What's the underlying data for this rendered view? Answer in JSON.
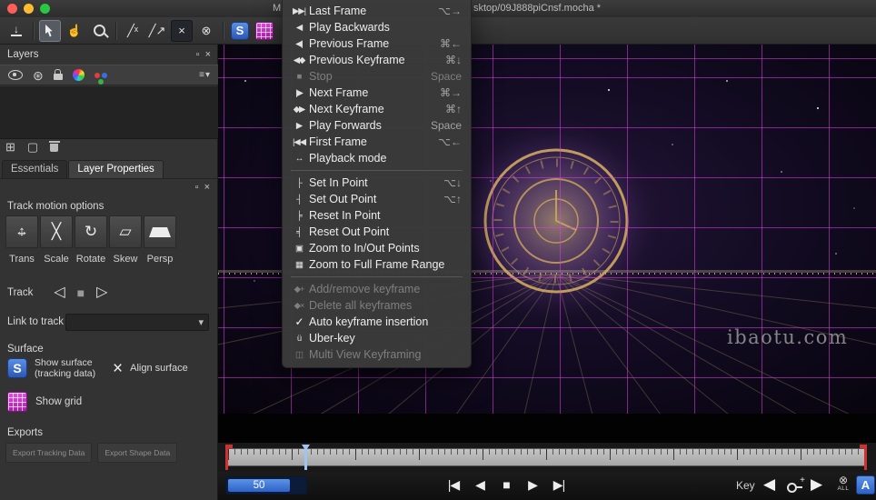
{
  "window": {
    "title_fragment_left": "M",
    "title_fragment_right": "sktop/09J888piCnsf.mocha *"
  },
  "colors": {
    "accent_blue": "#2f6fd0",
    "magenta": "#d936d9",
    "grid_line": "rgba(226,62,226,0.55)",
    "gold": "#cfa85e",
    "red_marker": "#d03030",
    "playhead": "#9cc6f0"
  },
  "icons": {
    "save": "↓",
    "pan": "☝",
    "xspline": "╱ˣ",
    "bezier": "╱↗",
    "x_tool": "×",
    "circle_x": "⊗",
    "surface": "S",
    "float_panel": "▫",
    "close_panel": "×",
    "gear": "⊛",
    "list_menu": "≡▾",
    "group": "⊞",
    "page": "▢",
    "arrow_h": "↔",
    "arrow_v": "↕",
    "scale": "╳",
    "rotate": "↻",
    "skew": "▱",
    "track_back": "◁",
    "track_stop": "■",
    "track_fwd": "▷",
    "select_arrow": "▾",
    "align_x": "×",
    "plus": "+",
    "all_visibility": "⊗",
    "transport_prev_key": "|◀",
    "transport_step_back": "◀",
    "transport_stop": "■",
    "transport_step_fwd": "▶",
    "transport_next_key": "▶|",
    "key_prev": "◀",
    "key_next": "▶"
  },
  "layers_panel": {
    "title": "Layers"
  },
  "tabs": [
    {
      "label": "Essentials",
      "active": false
    },
    {
      "label": "Layer Properties",
      "active": true
    }
  ],
  "track_panel": {
    "motion_title": "Track motion options",
    "motion_buttons": [
      {
        "label": "Trans"
      },
      {
        "label": "Scale"
      },
      {
        "label": "Rotate"
      },
      {
        "label": "Skew"
      },
      {
        "label": "Persp"
      }
    ],
    "track_label": "Track",
    "link_label": "Link to track",
    "surface_label": "Surface",
    "show_surface_line1": "Show surface",
    "show_surface_line2": "(tracking data)",
    "align_surface": "Align surface",
    "show_grid": "Show grid",
    "exports_label": "Exports",
    "export_buttons": [
      "Export Tracking Data",
      "Export Shape Data"
    ]
  },
  "context_menu": {
    "items": [
      {
        "id": "last-frame",
        "icon": "▶▶|",
        "label": "Last Frame",
        "shortcut": "⌥→"
      },
      {
        "id": "play-backwards",
        "icon": "◀",
        "label": "Play Backwards",
        "shortcut": ""
      },
      {
        "id": "previous-frame",
        "icon": "◀|",
        "label": "Previous Frame",
        "shortcut": "⌘←"
      },
      {
        "id": "previous-keyframe",
        "icon": "◀◆",
        "label": "Previous Keyframe",
        "shortcut": "⌘↓"
      },
      {
        "id": "stop",
        "icon": "■",
        "label": "Stop",
        "shortcut": "Space",
        "disabled": true
      },
      {
        "id": "next-frame",
        "icon": "|▶",
        "label": "Next Frame",
        "shortcut": "⌘→"
      },
      {
        "id": "next-keyframe",
        "icon": "◆▶",
        "label": "Next Keyframe",
        "shortcut": "⌘↑"
      },
      {
        "id": "play-forwards",
        "icon": "▶",
        "label": "Play Forwards",
        "shortcut": "Space"
      },
      {
        "id": "first-frame",
        "icon": "|◀◀",
        "label": "First Frame",
        "shortcut": "⌥←"
      },
      {
        "id": "playback-mode",
        "icon": "↔",
        "label": "Playback mode",
        "shortcut": ""
      },
      {
        "separator": true
      },
      {
        "id": "set-in-point",
        "icon": "├",
        "label": "Set In Point",
        "shortcut": "⌥↓"
      },
      {
        "id": "set-out-point",
        "icon": "┤",
        "label": "Set Out Point",
        "shortcut": "⌥↑"
      },
      {
        "id": "reset-in-point",
        "icon": "╞",
        "label": "Reset In Point",
        "shortcut": ""
      },
      {
        "id": "reset-out-point",
        "icon": "╡",
        "label": "Reset Out Point",
        "shortcut": ""
      },
      {
        "id": "zoom-to-in-out-points",
        "icon": "▣",
        "label": "Zoom to In/Out Points",
        "shortcut": ""
      },
      {
        "id": "zoom-to-full-frame-range",
        "icon": "▦",
        "label": "Zoom to Full Frame Range",
        "shortcut": ""
      },
      {
        "separator": true
      },
      {
        "id": "add-remove-keyframe",
        "icon": "◆+",
        "label": "Add/remove keyframe",
        "shortcut": "",
        "disabled": true
      },
      {
        "id": "delete-all-keyframes",
        "icon": "◆×",
        "label": "Delete all keyframes",
        "shortcut": "",
        "disabled": true
      },
      {
        "id": "auto-keyframe-insertion",
        "icon": "✓",
        "label": "Auto keyframe insertion",
        "shortcut": "",
        "checked": true
      },
      {
        "id": "uber-key",
        "icon": "ü",
        "label": "Uber-key",
        "shortcut": ""
      },
      {
        "id": "multi-view-keyframing",
        "icon": "◫",
        "label": "Multi View Keyframing",
        "shortcut": "",
        "disabled": true
      }
    ]
  },
  "viewport": {
    "watermark": "ibaotu.com"
  },
  "timeline": {
    "current_frame": "50"
  },
  "bottom_bar": {
    "key_label": "Key",
    "all_label": "ALL",
    "a_label": "A"
  }
}
